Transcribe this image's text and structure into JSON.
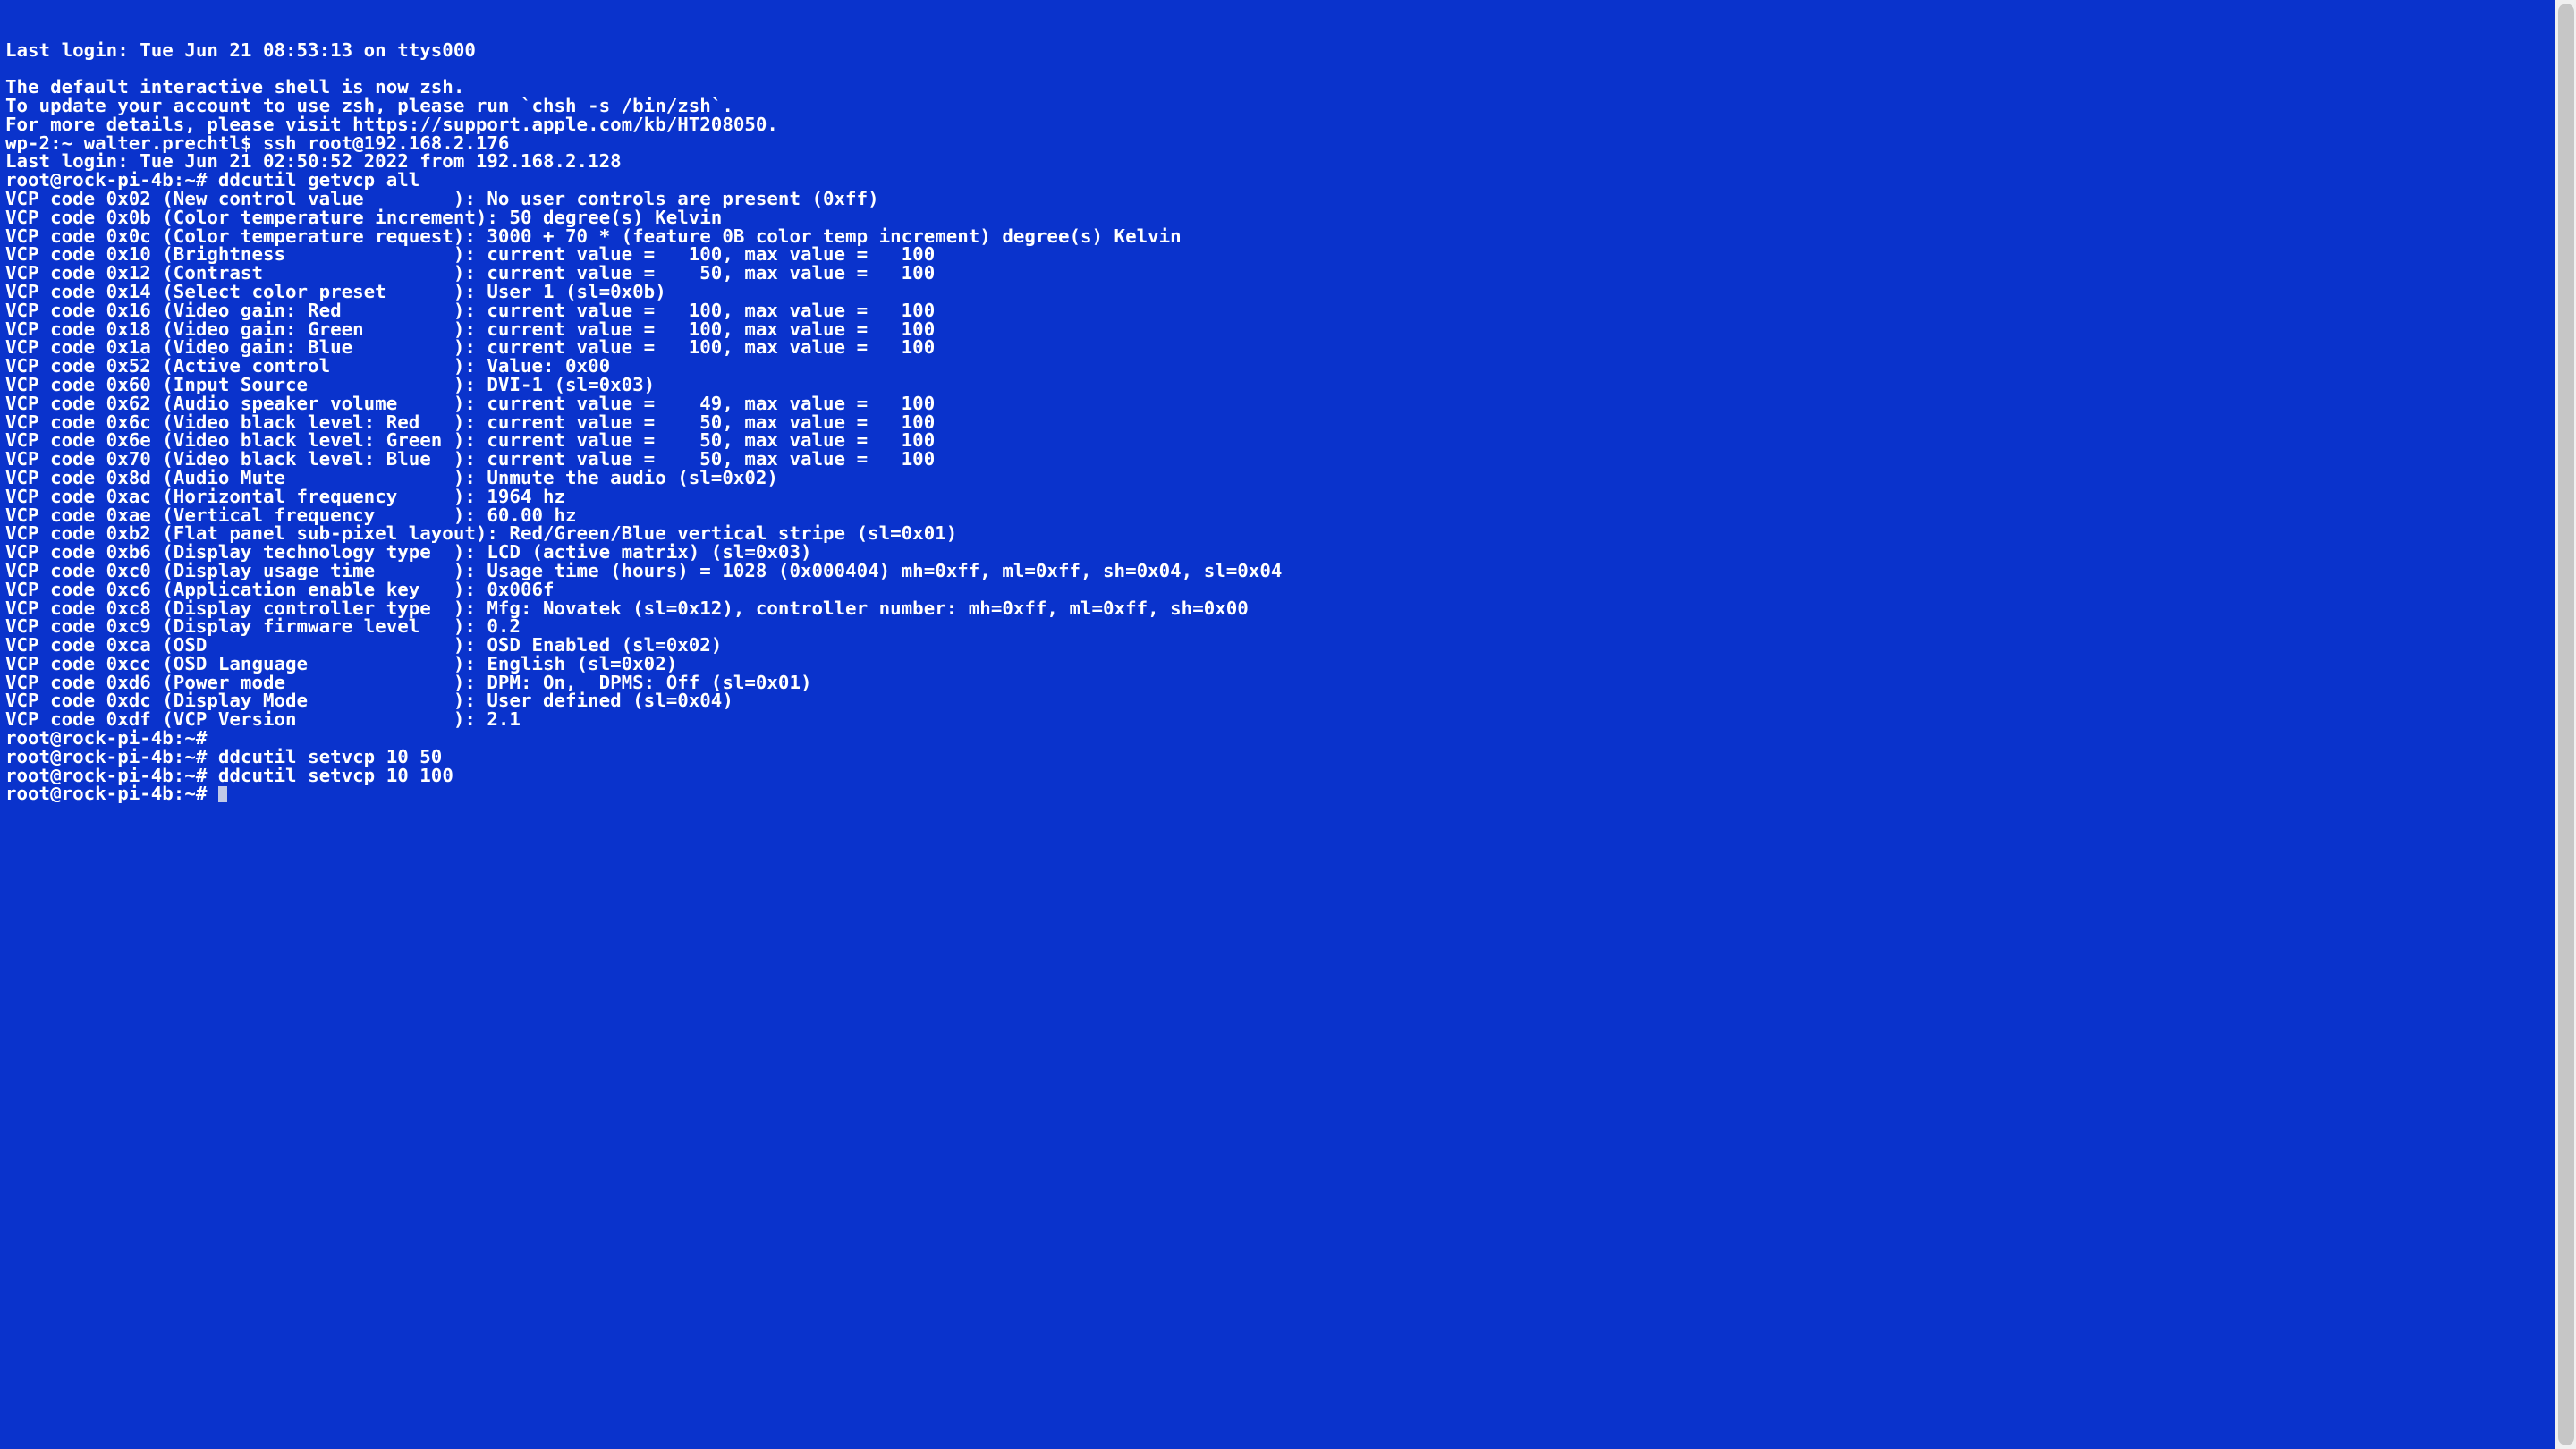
{
  "colors": {
    "background": "#0a33cc",
    "text": "#ffffff",
    "cursor": "#c0c9e8"
  },
  "preamble": [
    "Last login: Tue Jun 21 08:53:13 on ttys000",
    "",
    "The default interactive shell is now zsh.",
    "To update your account to use zsh, please run `chsh -s /bin/zsh`.",
    "For more details, please visit https://support.apple.com/kb/HT208050.",
    "wp-2:~ walter.prechtl$ ssh root@192.168.2.176",
    "Last login: Tue Jun 21 02:50:52 2022 from 192.168.2.128"
  ],
  "prompt_string": "root@rock-pi-4b:~#",
  "commands": {
    "getvcp": "ddcutil getvcp all",
    "empty": "",
    "setvcp50": "ddcutil setvcp 10 50",
    "setvcp100": "ddcutil setvcp 10 100"
  },
  "vcp_label_width": 40,
  "vcp": [
    {
      "code": "0x02",
      "name": "New control value",
      "val": "No user controls are present (0xff)"
    },
    {
      "code": "0x0b",
      "name": "Color temperature increment",
      "val": "50 degree(s) Kelvin"
    },
    {
      "code": "0x0c",
      "name": "Color temperature request",
      "val": "3000 + 70 * (feature 0B color temp increment) degree(s) Kelvin"
    },
    {
      "code": "0x10",
      "name": "Brightness",
      "cur": 100,
      "max": 100
    },
    {
      "code": "0x12",
      "name": "Contrast",
      "cur": 50,
      "max": 100
    },
    {
      "code": "0x14",
      "name": "Select color preset",
      "val": "User 1 (sl=0x0b)"
    },
    {
      "code": "0x16",
      "name": "Video gain: Red",
      "cur": 100,
      "max": 100
    },
    {
      "code": "0x18",
      "name": "Video gain: Green",
      "cur": 100,
      "max": 100
    },
    {
      "code": "0x1a",
      "name": "Video gain: Blue",
      "cur": 100,
      "max": 100
    },
    {
      "code": "0x52",
      "name": "Active control",
      "val": "Value: 0x00"
    },
    {
      "code": "0x60",
      "name": "Input Source",
      "val": "DVI-1 (sl=0x03)"
    },
    {
      "code": "0x62",
      "name": "Audio speaker volume",
      "cur": 49,
      "max": 100
    },
    {
      "code": "0x6c",
      "name": "Video black level: Red",
      "cur": 50,
      "max": 100
    },
    {
      "code": "0x6e",
      "name": "Video black level: Green",
      "cur": 50,
      "max": 100
    },
    {
      "code": "0x70",
      "name": "Video black level: Blue",
      "cur": 50,
      "max": 100
    },
    {
      "code": "0x8d",
      "name": "Audio Mute",
      "val": "Unmute the audio (sl=0x02)"
    },
    {
      "code": "0xac",
      "name": "Horizontal frequency",
      "val": "1964 hz"
    },
    {
      "code": "0xae",
      "name": "Vertical frequency",
      "val": "60.00 hz"
    },
    {
      "code": "0xb2",
      "name": "Flat panel sub-pixel layout",
      "val": "Red/Green/Blue vertical stripe (sl=0x01)"
    },
    {
      "code": "0xb6",
      "name": "Display technology type",
      "val": "LCD (active matrix) (sl=0x03)"
    },
    {
      "code": "0xc0",
      "name": "Display usage time",
      "val": "Usage time (hours) = 1028 (0x000404) mh=0xff, ml=0xff, sh=0x04, sl=0x04"
    },
    {
      "code": "0xc6",
      "name": "Application enable key",
      "val": "0x006f"
    },
    {
      "code": "0xc8",
      "name": "Display controller type",
      "val": "Mfg: Novatek (sl=0x12), controller number: mh=0xff, ml=0xff, sh=0x00"
    },
    {
      "code": "0xc9",
      "name": "Display firmware level",
      "val": "0.2"
    },
    {
      "code": "0xca",
      "name": "OSD",
      "val": "OSD Enabled (sl=0x02)"
    },
    {
      "code": "0xcc",
      "name": "OSD Language",
      "val": "English (sl=0x02)"
    },
    {
      "code": "0xd6",
      "name": "Power mode",
      "val": "DPM: On,  DPMS: Off (sl=0x01)"
    },
    {
      "code": "0xdc",
      "name": "Display Mode",
      "val": "User defined (sl=0x04)"
    },
    {
      "code": "0xdf",
      "name": "VCP Version",
      "val": "2.1"
    }
  ]
}
